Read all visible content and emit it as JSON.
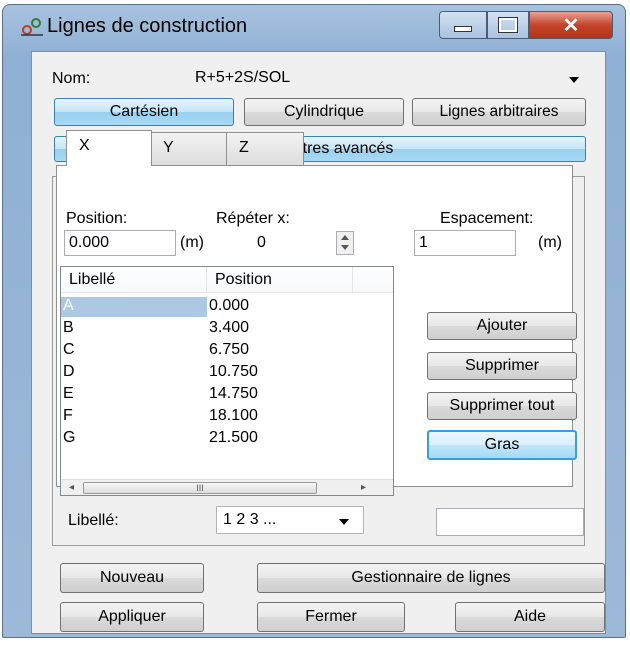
{
  "window": {
    "title": "Lignes de construction",
    "icon": "construction-lines-icon"
  },
  "titlebar_controls": {
    "minimize_icon": "minimize-icon",
    "maximize_icon": "maximize-icon",
    "close_glyph": "✕"
  },
  "name": {
    "label": "Nom:",
    "value": "R+5+2S/SOL"
  },
  "modes": {
    "cartesian": "Cartésien",
    "cylindrical": "Cylindrique",
    "arbitrary": "Lignes arbitraires"
  },
  "advanced_button": "Paramètres avancés",
  "tabs": [
    "X",
    "Y",
    "Z"
  ],
  "position": {
    "label": "Position:",
    "value": "0.000",
    "unit": "(m)"
  },
  "repeat": {
    "label": "Répéter x:",
    "value": "0"
  },
  "spacing": {
    "label": "Espacement:",
    "value": "1",
    "unit": "(m)"
  },
  "table": {
    "headers": [
      "Libellé",
      "Position"
    ],
    "rows": [
      {
        "label": "A",
        "position": "0.000"
      },
      {
        "label": "B",
        "position": "3.400"
      },
      {
        "label": "C",
        "position": "6.750"
      },
      {
        "label": "D",
        "position": "10.750"
      },
      {
        "label": "E",
        "position": "14.750"
      },
      {
        "label": "F",
        "position": "18.100"
      },
      {
        "label": "G",
        "position": "21.500"
      }
    ],
    "scroll_left": "◂",
    "scroll_thumb": "III",
    "scroll_right": "▸"
  },
  "side_buttons": {
    "add": "Ajouter",
    "delete": "Supprimer",
    "delete_all": "Supprimer tout",
    "bold": "Gras"
  },
  "label_style": {
    "label": "Libellé:",
    "value": "1 2 3 ..."
  },
  "bottom_buttons": {
    "new": "Nouveau",
    "manager": "Gestionnaire de lignes",
    "apply": "Appliquer",
    "close": "Fermer",
    "help": "Aide"
  },
  "colors": {
    "accent": "#3c9ed8",
    "selection": "#adc8e2",
    "close_button": "#c5442a"
  }
}
